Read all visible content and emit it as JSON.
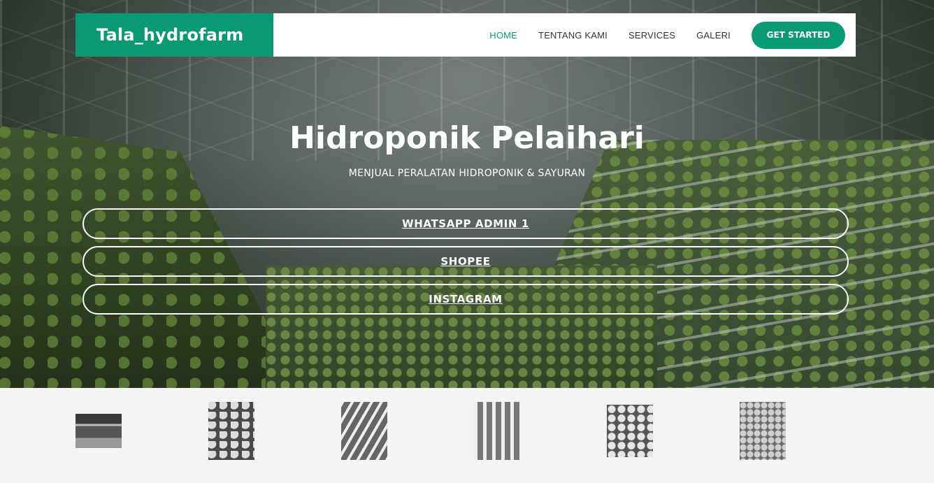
{
  "brand": {
    "name": "Tala_hydrofarm",
    "accent_color": "#0a9a73"
  },
  "nav": {
    "items": [
      {
        "label": "HOME",
        "active": true
      },
      {
        "label": "TENTANG KAMI",
        "active": false
      },
      {
        "label": "SERVICES",
        "active": false
      },
      {
        "label": "GALERI",
        "active": false
      }
    ],
    "cta_label": "GET STARTED"
  },
  "hero": {
    "title": "Hidroponik Pelaihari",
    "subtitle": "MENJUAL PERALATAN HIDROPONIK & SAYURAN",
    "buttons": [
      {
        "label": "WHATSAPP ADMIN 1"
      },
      {
        "label": "SHOPEE"
      },
      {
        "label": "INSTAGRAM"
      }
    ]
  },
  "gallery": {
    "thumbnails": [
      {
        "icon": "greenhouse-photo"
      },
      {
        "icon": "plant-leaves-photo"
      },
      {
        "icon": "hydroponic-rows-photo"
      },
      {
        "icon": "hydroponic-pipes-photo"
      },
      {
        "icon": "lettuce-closeup-photo"
      },
      {
        "icon": "vegetable-field-photo"
      }
    ]
  }
}
